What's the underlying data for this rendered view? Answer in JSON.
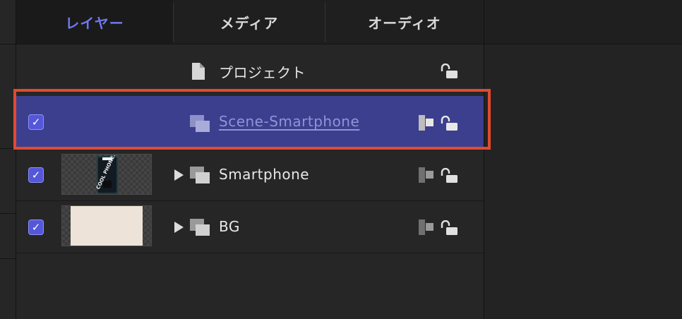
{
  "tabs": [
    {
      "label": "レイヤー",
      "active": true
    },
    {
      "label": "メディア",
      "active": false
    },
    {
      "label": "オーディオ",
      "active": false
    }
  ],
  "project_row": {
    "label": "プロジェクト",
    "icon": "document-icon",
    "lock_icon": "unlock-icon"
  },
  "layers": [
    {
      "name": "Scene-Smartphone",
      "checked": true,
      "selected": true,
      "icon": "group-icon"
    },
    {
      "name": "Smartphone",
      "checked": true,
      "selected": false,
      "icon": "group-icon",
      "thumbnail_text": "COOL PHONE!"
    },
    {
      "name": "BG",
      "checked": true,
      "selected": false,
      "icon": "group-icon"
    }
  ],
  "colors": {
    "accent": "#6f78f0",
    "selection_bg": "#3c3f8e",
    "highlight_border": "#e24a30",
    "checkbox": "#5457d9"
  }
}
